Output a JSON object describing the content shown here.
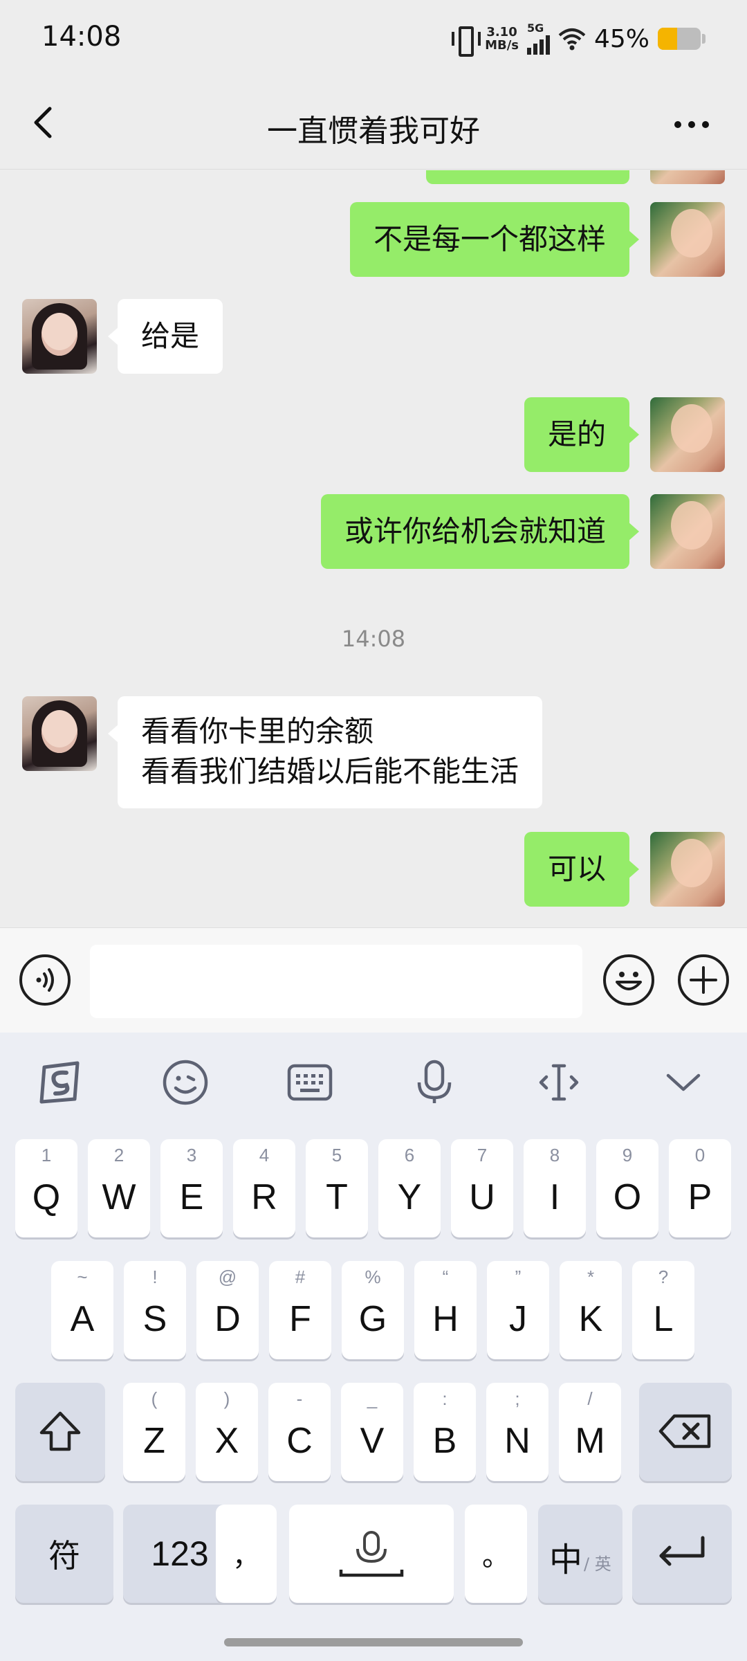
{
  "status_bar": {
    "time": "14:08",
    "net_speed_value": "3.10",
    "net_speed_unit": "MB/s",
    "network": "5G",
    "battery_text": "45%",
    "battery_level": 0.45,
    "battery_color": "#f5b400"
  },
  "nav": {
    "title": "一直惯着我可好",
    "back_icon": "chevron-left-icon",
    "more_icon": "more-dots-icon"
  },
  "messages": [
    {
      "from": "me",
      "text": "不是每一个都这样"
    },
    {
      "from": "them",
      "text": "给是"
    },
    {
      "from": "me",
      "text": "是的"
    },
    {
      "from": "me",
      "text": "或许你给机会就知道"
    },
    {
      "timestamp": "14:08"
    },
    {
      "from": "them",
      "lines": [
        "看看你卡里的余额",
        "看看我们结婚以后能不能生活"
      ]
    },
    {
      "from": "me",
      "text": "可以"
    }
  ],
  "chat": {
    "m0": "不是每一个都这样",
    "m1": "给是",
    "m2": "是的",
    "m3": "或许你给机会就知道",
    "ts": "14:08",
    "m4_line1": "看看你卡里的余额",
    "m4_line2": "看看我们结婚以后能不能生活",
    "m5": "可以",
    "bubble_color_me": "#95ec69",
    "bubble_color_them": "#ffffff"
  },
  "input_bar": {
    "voice_icon": "voice-icon",
    "emoji_icon": "emoji-icon",
    "plus_icon": "plus-icon",
    "text_value": ""
  },
  "keyboard": {
    "toolbar": [
      "sogou-logo-icon",
      "emoji-icon",
      "keyboard-icon",
      "microphone-icon",
      "cursor-icon",
      "collapse-icon"
    ],
    "row1": [
      {
        "k": "Q",
        "s": "1"
      },
      {
        "k": "W",
        "s": "2"
      },
      {
        "k": "E",
        "s": "3"
      },
      {
        "k": "R",
        "s": "4"
      },
      {
        "k": "T",
        "s": "5"
      },
      {
        "k": "Y",
        "s": "6"
      },
      {
        "k": "U",
        "s": "7"
      },
      {
        "k": "I",
        "s": "8"
      },
      {
        "k": "O",
        "s": "9"
      },
      {
        "k": "P",
        "s": "0"
      }
    ],
    "row2": [
      {
        "k": "A",
        "s": "~"
      },
      {
        "k": "S",
        "s": "!"
      },
      {
        "k": "D",
        "s": "@"
      },
      {
        "k": "F",
        "s": "#"
      },
      {
        "k": "G",
        "s": "%"
      },
      {
        "k": "H",
        "s": "“"
      },
      {
        "k": "J",
        "s": "”"
      },
      {
        "k": "K",
        "s": "*"
      },
      {
        "k": "L",
        "s": "?"
      }
    ],
    "row3": [
      {
        "k": "Z",
        "s": "("
      },
      {
        "k": "X",
        "s": ")"
      },
      {
        "k": "C",
        "s": "-"
      },
      {
        "k": "V",
        "s": "_"
      },
      {
        "k": "B",
        "s": ":"
      },
      {
        "k": "N",
        "s": ";"
      },
      {
        "k": "M",
        "s": "/"
      }
    ],
    "symbols_label": "符",
    "numbers_label": "123",
    "comma_label": "，",
    "period_label": "。",
    "lang_main": "中",
    "lang_sub": "/ 英"
  }
}
